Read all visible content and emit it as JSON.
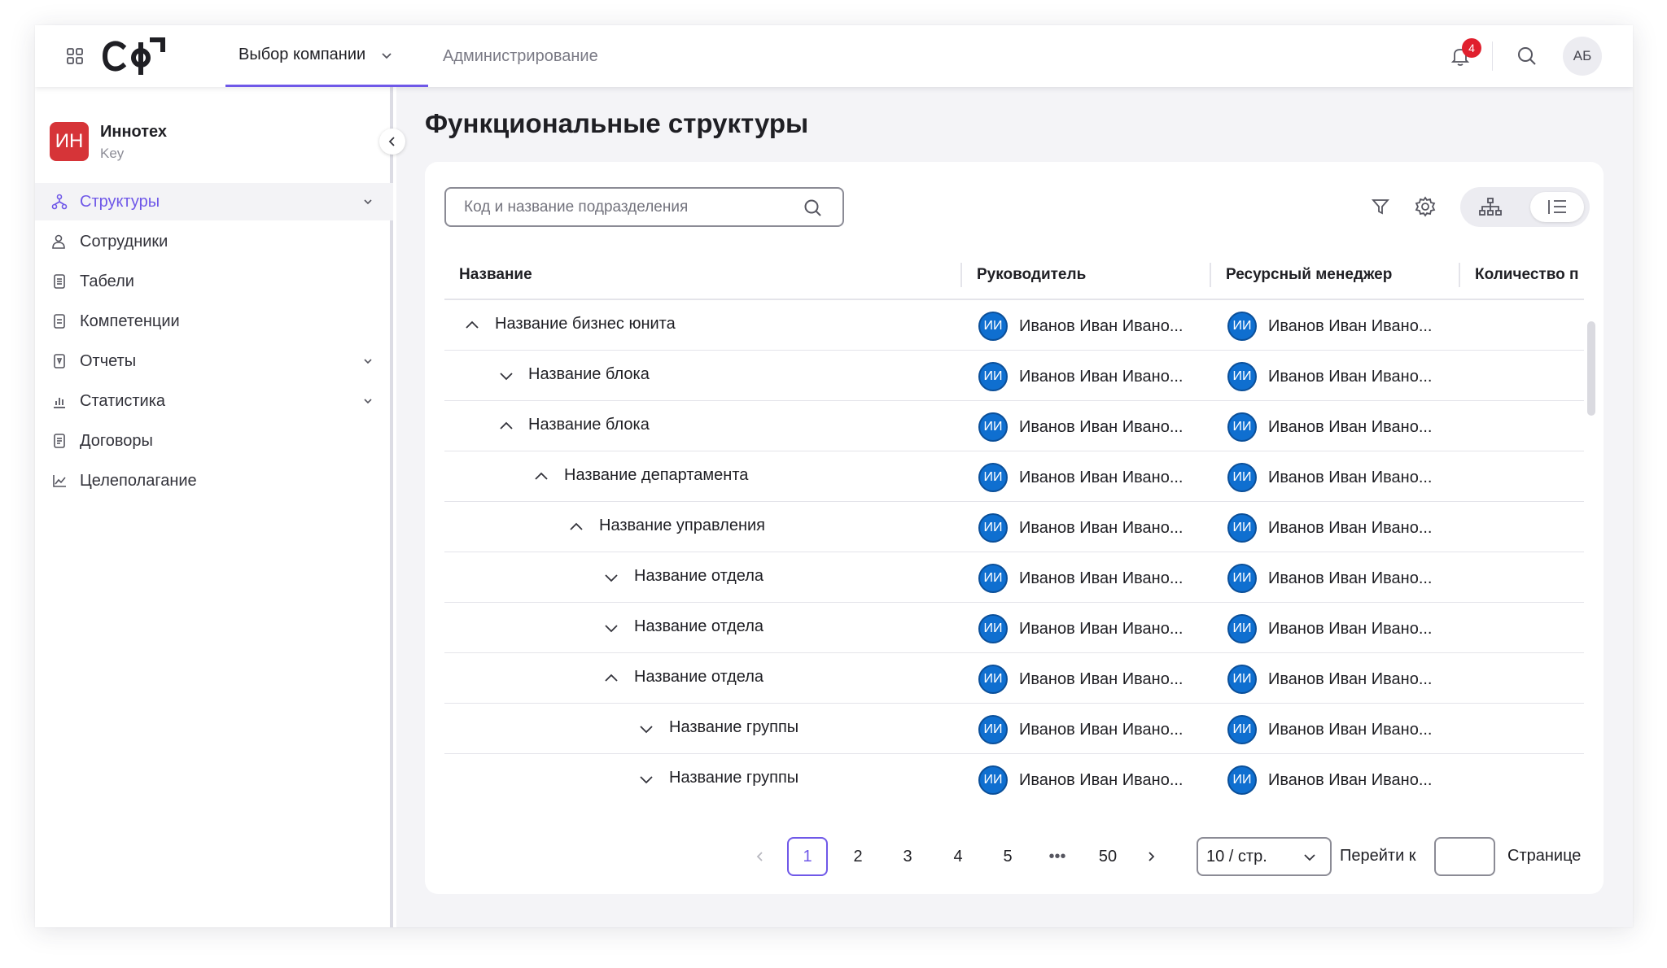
{
  "header": {
    "logo_text": "СФ",
    "nav": [
      {
        "label": "Выбор компании"
      },
      {
        "label": "Администрирование"
      }
    ],
    "notifications_count": "4",
    "user_initials": "АБ"
  },
  "sidebar": {
    "company": {
      "initials": "ИН",
      "name": "Иннотех",
      "subtitle": "Key"
    },
    "items": [
      {
        "label": "Структуры",
        "icon": "structure-icon",
        "active": true,
        "has_children": true
      },
      {
        "label": "Сотрудники",
        "icon": "users-icon",
        "has_children": false
      },
      {
        "label": "Табели",
        "icon": "document-icon",
        "has_children": false
      },
      {
        "label": "Компетенции",
        "icon": "book-icon",
        "has_children": false
      },
      {
        "label": "Отчеты",
        "icon": "report-icon",
        "has_children": true
      },
      {
        "label": "Статистика",
        "icon": "bar-chart-icon",
        "has_children": true
      },
      {
        "label": "Договоры",
        "icon": "contract-icon",
        "has_children": false
      },
      {
        "label": "Целеполагание",
        "icon": "line-chart-icon",
        "has_children": false
      }
    ]
  },
  "main": {
    "title": "Функциональные структуры",
    "search": {
      "placeholder": "Код и название подразделения"
    },
    "columns": [
      "Название",
      "Руководитель",
      "Ресурсный менеджер",
      "Количество п"
    ],
    "rows": [
      {
        "name": "Название бизнес юнита",
        "expanded": true,
        "level": 0,
        "manager": {
          "initials": "ИИ",
          "name": "Иванов Иван Ивано..."
        },
        "resource_manager": {
          "initials": "ИИ",
          "name": "Иванов Иван Ивано..."
        }
      },
      {
        "name": "Название блока",
        "expanded": false,
        "level": 1,
        "manager": {
          "initials": "ИИ",
          "name": "Иванов Иван Ивано..."
        },
        "resource_manager": {
          "initials": "ИИ",
          "name": "Иванов Иван Ивано..."
        }
      },
      {
        "name": "Название блока",
        "expanded": true,
        "level": 1,
        "manager": {
          "initials": "ИИ",
          "name": "Иванов Иван Ивано..."
        },
        "resource_manager": {
          "initials": "ИИ",
          "name": "Иванов Иван Ивано..."
        }
      },
      {
        "name": "Название департамента",
        "expanded": true,
        "level": 2,
        "manager": {
          "initials": "ИИ",
          "name": "Иванов Иван Ивано..."
        },
        "resource_manager": {
          "initials": "ИИ",
          "name": "Иванов Иван Ивано..."
        }
      },
      {
        "name": "Название управления",
        "expanded": true,
        "level": 3,
        "manager": {
          "initials": "ИИ",
          "name": "Иванов Иван Ивано..."
        },
        "resource_manager": {
          "initials": "ИИ",
          "name": "Иванов Иван Ивано..."
        }
      },
      {
        "name": "Название отдела",
        "expanded": false,
        "level": 4,
        "manager": {
          "initials": "ИИ",
          "name": "Иванов Иван Ивано..."
        },
        "resource_manager": {
          "initials": "ИИ",
          "name": "Иванов Иван Ивано..."
        }
      },
      {
        "name": "Название отдела",
        "expanded": false,
        "level": 4,
        "manager": {
          "initials": "ИИ",
          "name": "Иванов Иван Ивано..."
        },
        "resource_manager": {
          "initials": "ИИ",
          "name": "Иванов Иван Ивано..."
        }
      },
      {
        "name": "Название отдела",
        "expanded": true,
        "level": 4,
        "manager": {
          "initials": "ИИ",
          "name": "Иванов Иван Ивано..."
        },
        "resource_manager": {
          "initials": "ИИ",
          "name": "Иванов Иван Ивано..."
        }
      },
      {
        "name": "Название группы",
        "expanded": false,
        "level": 5,
        "manager": {
          "initials": "ИИ",
          "name": "Иванов Иван Ивано..."
        },
        "resource_manager": {
          "initials": "ИИ",
          "name": "Иванов Иван Ивано..."
        }
      },
      {
        "name": "Название группы",
        "expanded": false,
        "level": 5,
        "manager": {
          "initials": "ИИ",
          "name": "Иванов Иван Ивано..."
        },
        "resource_manager": {
          "initials": "ИИ",
          "name": "Иванов Иван Ивано..."
        }
      }
    ],
    "pagination": {
      "pages": [
        "1",
        "2",
        "3",
        "4",
        "5"
      ],
      "ellipsis": "•••",
      "last_page": "50",
      "current": "1",
      "page_size": "10 / стр.",
      "goto_label": "Перейти к",
      "page_label": "Странице"
    }
  },
  "colors": {
    "accent": "#6f58e8",
    "avatar": "#0f6fd0",
    "badge": "#e0202e",
    "company_logo": "#d63438"
  }
}
